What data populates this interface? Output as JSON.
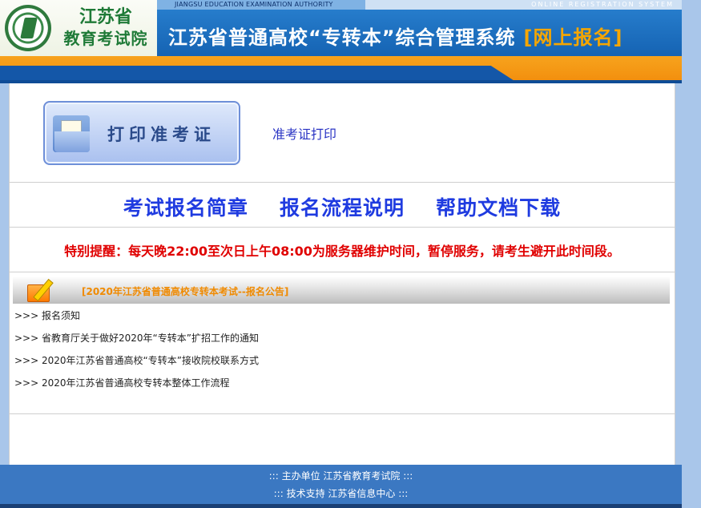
{
  "header": {
    "logo_line1": "江苏省",
    "logo_line2": "教育考试院",
    "english_left": "JIANGSU EDUCATION EXAMINATION AUTHORITY",
    "english_right": "ONLINE REGISTRATION SYSTEM",
    "system_title": "江苏省普通高校“专转本”综合管理系统",
    "online_tag": "[网上报名]"
  },
  "print_section": {
    "button_label": "打印准考证",
    "link_text": "准考证打印"
  },
  "nav": {
    "links": [
      "考试报名简章",
      "报名流程说明",
      "帮助文档下载"
    ]
  },
  "notice": {
    "text": "特别提醒：每天晚22:00至次日上午08:00为服务器维护时间，暂停服务，请考生避开此时间段。"
  },
  "announcements": {
    "title": "[2020年江苏省普通高校专转本考试--报名公告]",
    "items": [
      ">>> 报名须知",
      ">>> 省教育厅关于做好2020年“专转本”扩招工作的通知",
      ">>> 2020年江苏省普通高校“专转本”接收院校联系方式",
      ">>> 2020年江苏省普通高校专转本整体工作流程"
    ]
  },
  "footer": {
    "line1": "::: 主办单位 江苏省教育考试院 :::",
    "line2": "::: 技术支持 江苏省信息中心 :::"
  },
  "colors": {
    "header_blue": "#1c6fc0",
    "orange": "#f28d0c",
    "nav_link": "#1f3be0",
    "notice_red": "#e00000",
    "announce_orange": "#f08a00",
    "footer_blue": "#3b78c2"
  }
}
